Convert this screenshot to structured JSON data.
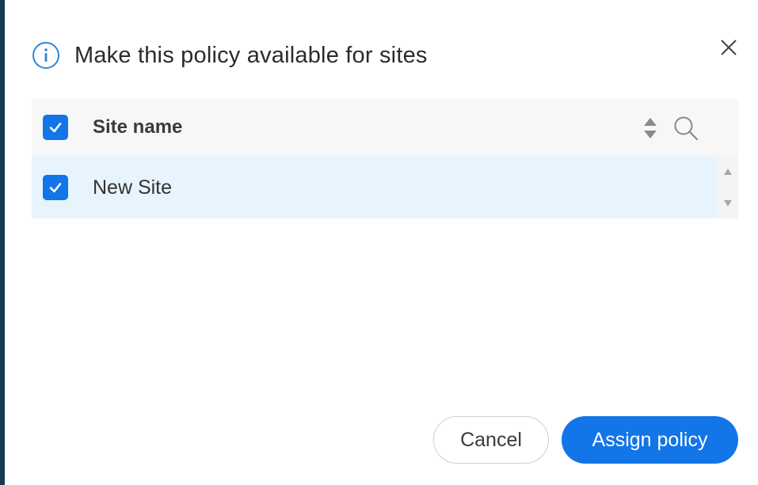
{
  "dialog": {
    "title": "Make this policy available for sites",
    "info_icon": "info-circle-icon",
    "close_icon": "close-icon"
  },
  "table": {
    "header": {
      "select_all_checked": true,
      "column_label": "Site name",
      "sort_icon": "sort-icon",
      "search_icon": "search-icon"
    },
    "rows": [
      {
        "checked": true,
        "site_name": "New Site"
      }
    ]
  },
  "footer": {
    "cancel_label": "Cancel",
    "assign_label": "Assign policy"
  },
  "colors": {
    "accent": "#1275e8",
    "selected_row": "#e8f4fd",
    "header_bg": "#f7f7f7",
    "edge": "#163a4f"
  }
}
